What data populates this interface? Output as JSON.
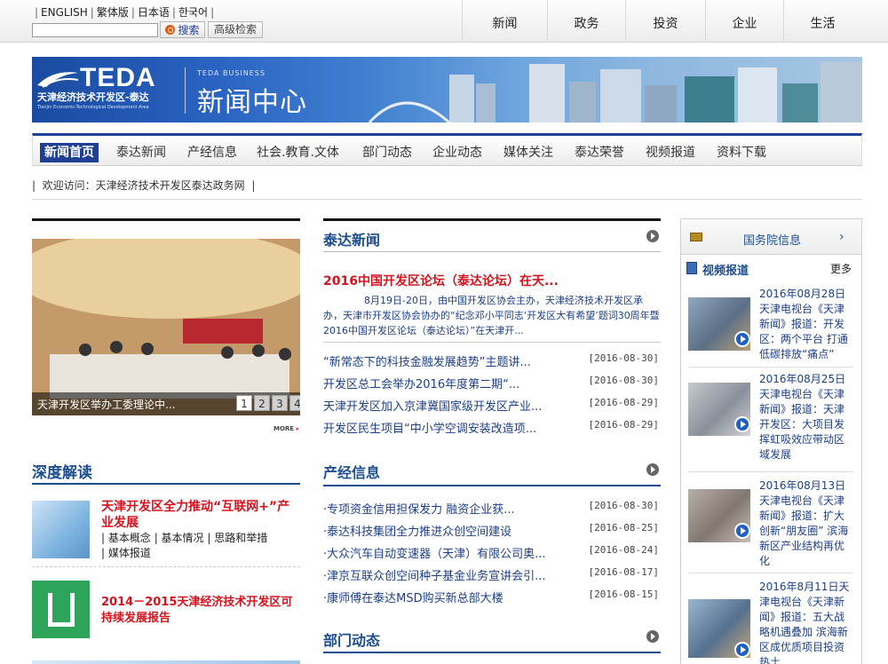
{
  "top": {
    "languages": [
      "ENGLISH",
      "繁体版",
      "日本语",
      "한국어"
    ],
    "search_placeholder": "",
    "search_label": "搜索",
    "advanced_search_label": "高级检索",
    "main_nav": [
      "新闻",
      "政务",
      "投资",
      "企业",
      "生活"
    ]
  },
  "banner": {
    "logo_text": "TEDA",
    "logo_cn": "天津经济技术开发区-泰达",
    "logo_en": "Tianjin Economic-Technological Development Area",
    "subtitle": "TEDA BUSINESS",
    "title": "新闻中心"
  },
  "subnav": {
    "items": [
      "新闻首页",
      "泰达新闻",
      "产经信息",
      "社会.教育.文体",
      "部门动态",
      "企业动态",
      "媒体关注",
      "泰达荣誉",
      "视频报道",
      "资料下载"
    ],
    "active_index": 0
  },
  "welcome": "欢迎访问：天津经济技术开发区泰达政务网",
  "slider": {
    "caption": "天津开发区举办工委理论中...",
    "pages": [
      "1",
      "2",
      "3",
      "4"
    ],
    "active_page": 0,
    "more_label": "MORE"
  },
  "depth": {
    "title": "深度解读",
    "item1_title": "天津开发区全力推动“互联网+”产业发展",
    "item1_links": [
      "基本概念",
      "基本情况",
      "思路和举措",
      "媒体报道"
    ],
    "item2_title": "2014－2015天津经济技术开发区可持续发展报告"
  },
  "teda_news": {
    "title": "泰达新闻",
    "headline": "2016中国开发区论坛（泰达论坛）在天...",
    "summary": "8月19日-20日，由中国开发区协会主办，天津经济技术开发区承办，天津市开发区协会协办的“纪念邓小平同志‘开发区大有希望’题词30周年暨2016中国开发区论坛（泰达论坛）”在天津开...",
    "items": [
      {
        "title": "“新常态下的科技金融发展趋势”主题讲...",
        "date": "[2016-08-30]"
      },
      {
        "title": "开发区总工会举办2016年度第二期“...",
        "date": "[2016-08-30]"
      },
      {
        "title": "天津开发区加入京津冀国家级开发区产业...",
        "date": "[2016-08-29]"
      },
      {
        "title": "开发区民生项目“中小学空调安装改造项...",
        "date": "[2016-08-29]"
      }
    ]
  },
  "industry_news": {
    "title": "产经信息",
    "items": [
      {
        "title": "·专项资金信用担保发力 融资企业获...",
        "date": "[2016-08-30]"
      },
      {
        "title": "·泰达科技集团全力推进众创空间建设",
        "date": "[2016-08-25]"
      },
      {
        "title": "·大众汽车自动变速器（天津）有限公司奥...",
        "date": "[2016-08-24]"
      },
      {
        "title": "·津京互联众创空间种子基金业务宣讲会引...",
        "date": "[2016-08-17]"
      },
      {
        "title": "·康师傅在泰达MSD购买新总部大楼",
        "date": "[2016-08-15]"
      }
    ]
  },
  "dept_news": {
    "title": "部门动态"
  },
  "right": {
    "gov_label": "国务院信息",
    "video_label": "视频报道",
    "more_label": "更多",
    "videos": [
      "2016年08月28日天津电视台《天津新闻》报道：开发区：两个平台 打通低碳排放“痛点”",
      "2016年08月25日天津电视台《天津新闻》报道：天津开发区：大项目发挥虹吸效应带动区域发展",
      "2016年08月13日天津电视台《天津新闻》报道：扩大创新“朋友圈” 滨海新区产业结构再优化",
      "2016年8月11日天津电视台《天津新闻》报道：五大战略机遇叠加 滨海新区成优质项目投资热土"
    ]
  },
  "colors": {
    "brand_blue": "#1c4d8f",
    "nav_active": "#1e3f93",
    "headline_red": "#d6131d"
  }
}
